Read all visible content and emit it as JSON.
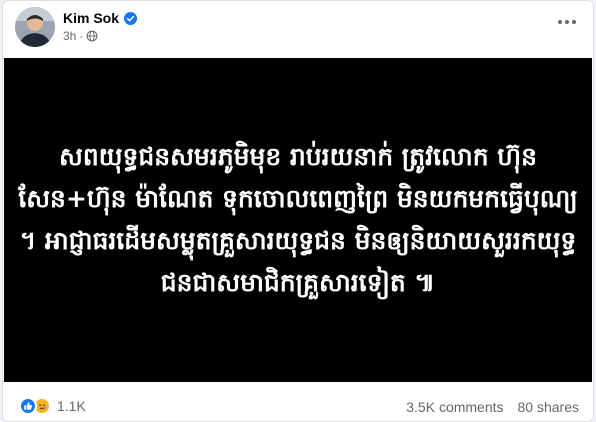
{
  "post": {
    "author": "Kim Sok",
    "time": "3h",
    "verified": true,
    "image_text": "សពយុទ្ធជនសមរភូមិមុខ រាប់រយនាក់ ត្រូវលោក ហ៊ុន សែន+ហ៊ុន ម៉ាណែត ទុកចោលពេញព្រៃ មិនយកមកធ្វើបុណ្យ ។ អាជ្ញាធរដើមសម្លុតគ្រួសារយុទ្ធជន មិនឲ្យនិយាយសួររកយុទ្ធជនជាសមាជិកគ្រួសារទៀត ៕"
  },
  "footer": {
    "reaction_count": "1.1K",
    "comments": "3.5K comments",
    "shares": "80 shares"
  },
  "icons": {
    "verified": "verified-badge-icon",
    "audience": "globe-icon",
    "like": "like-icon",
    "sad": "sad-icon",
    "more": "more-options-icon"
  },
  "colors": {
    "brand": "#1877f2",
    "sad": "#f7b125",
    "image_bg": "#000000",
    "image_text": "#ffffff"
  }
}
